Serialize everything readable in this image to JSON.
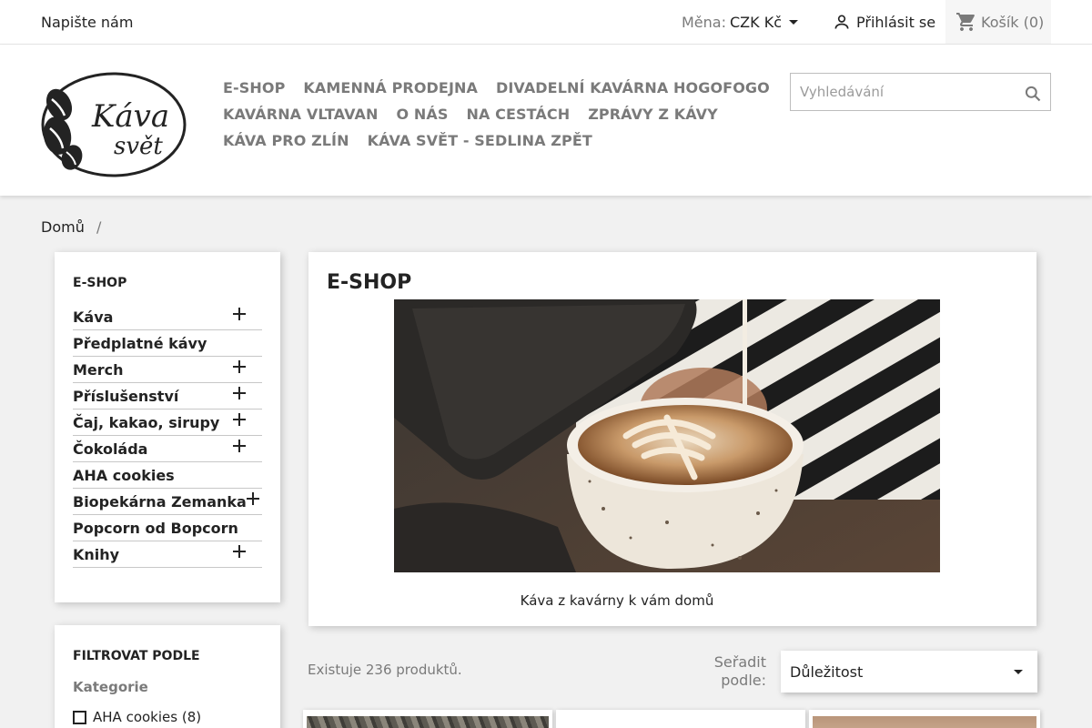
{
  "topbar": {
    "contact": "Napište nám",
    "currency_label": "Měna:",
    "currency_value": "CZK Kč",
    "login": "Přihlásit se",
    "cart": "Košík (0)"
  },
  "logo": {
    "line1": "Káva",
    "line2": "svět"
  },
  "nav": {
    "rows": [
      [
        "E-SHOP",
        "KAMENNÁ PRODEJNA",
        "DIVADELNÍ KAVÁRNA HOGOFOGO"
      ],
      [
        "KAVÁRNA VLTAVAN",
        "O NÁS",
        "NA CESTÁCH",
        "ZPRÁVY Z KÁVY"
      ],
      [
        "KÁVA PRO ZLÍN",
        "KÁVA SVĚT - SEDLINA ZPĚT"
      ]
    ]
  },
  "search": {
    "placeholder": "Vyhledávání"
  },
  "breadcrumb": {
    "home": "Domů",
    "separator": "/"
  },
  "sidebar": {
    "title": "E-SHOP",
    "categories": [
      {
        "label": "Káva",
        "expandable": true
      },
      {
        "label": "Předplatné kávy",
        "expandable": false
      },
      {
        "label": "Merch",
        "expandable": true
      },
      {
        "label": "Příslušenství",
        "expandable": true
      },
      {
        "label": "Čaj, kakao, sirupy",
        "expandable": true
      },
      {
        "label": "Čokoláda",
        "expandable": true
      },
      {
        "label": "AHA cookies",
        "expandable": false
      },
      {
        "label": "Biopekárna Zemanka",
        "expandable": true
      },
      {
        "label": "Popcorn od Bopcorn",
        "expandable": false
      },
      {
        "label": "Knihy",
        "expandable": true
      }
    ]
  },
  "filter": {
    "title": "FILTROVAT PODLE",
    "subtitle": "Kategorie",
    "option": "AHA cookies (8)"
  },
  "main": {
    "title": "E-SHOP",
    "caption": "Káva z kavárny k vám domů",
    "count": "Existuje 236 produktů.",
    "sort_label": "Seřadit podle:",
    "sort_value": "Důležitost"
  },
  "colors": {
    "text": "#232323",
    "muted": "#7a7a7a",
    "background": "#f1f1f1"
  }
}
